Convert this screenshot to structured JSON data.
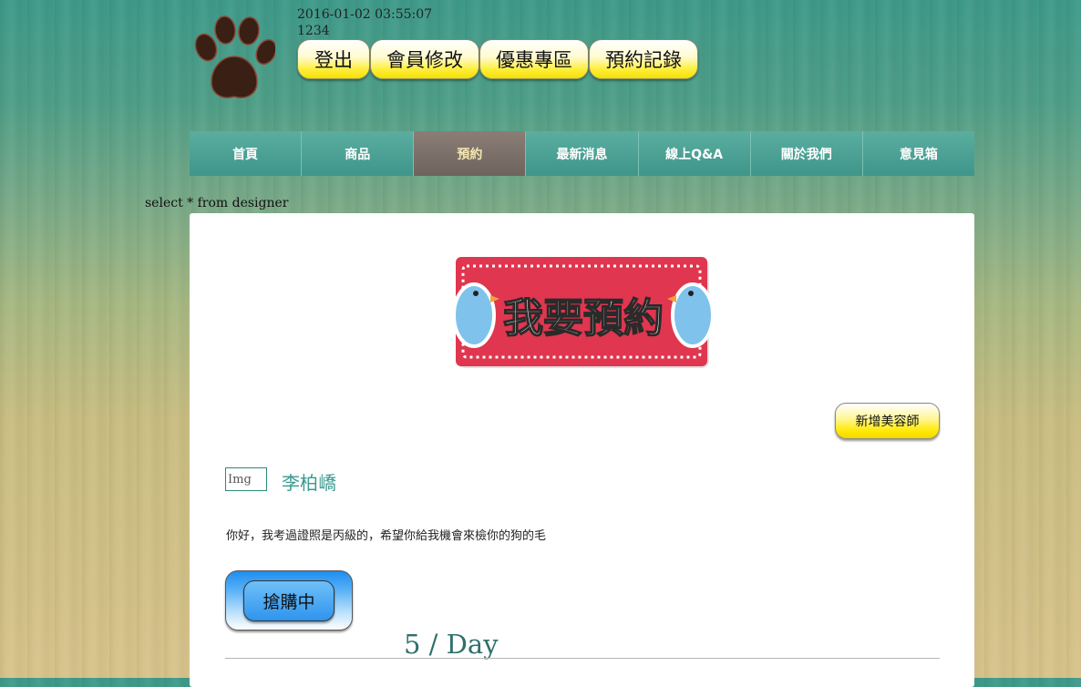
{
  "session": {
    "datetime": "2016-01-02 03:55:07",
    "user_id": "1234"
  },
  "top_buttons": {
    "logout": "登出",
    "member_edit": "會員修改",
    "promotions": "優惠專區",
    "booking_records": "預約記錄"
  },
  "nav": {
    "home": "首頁",
    "products": "商品",
    "booking": "預約",
    "news": "最新消息",
    "qa": "線上Q&A",
    "about": "關於我們",
    "feedback": "意見箱",
    "active": "預約"
  },
  "debug_text": "select * from designer",
  "banner": {
    "text": "我要預約"
  },
  "add_designer_label": "新增美容師",
  "designer": {
    "img_alt": "Img",
    "name": "李柏嶠",
    "message": "你好，我考過證照是丙級的，希望你給我機會來檢你的狗的毛",
    "buy_label": "搶購中",
    "rate": "5 / Day"
  },
  "colors": {
    "nav_teal": "#4aa195",
    "nav_active": "#7d726b",
    "button_yellow": "#ffe800",
    "button_blue": "#2f95ee",
    "banner_red": "#e0364f",
    "bird_blue": "#7fc3ec"
  }
}
